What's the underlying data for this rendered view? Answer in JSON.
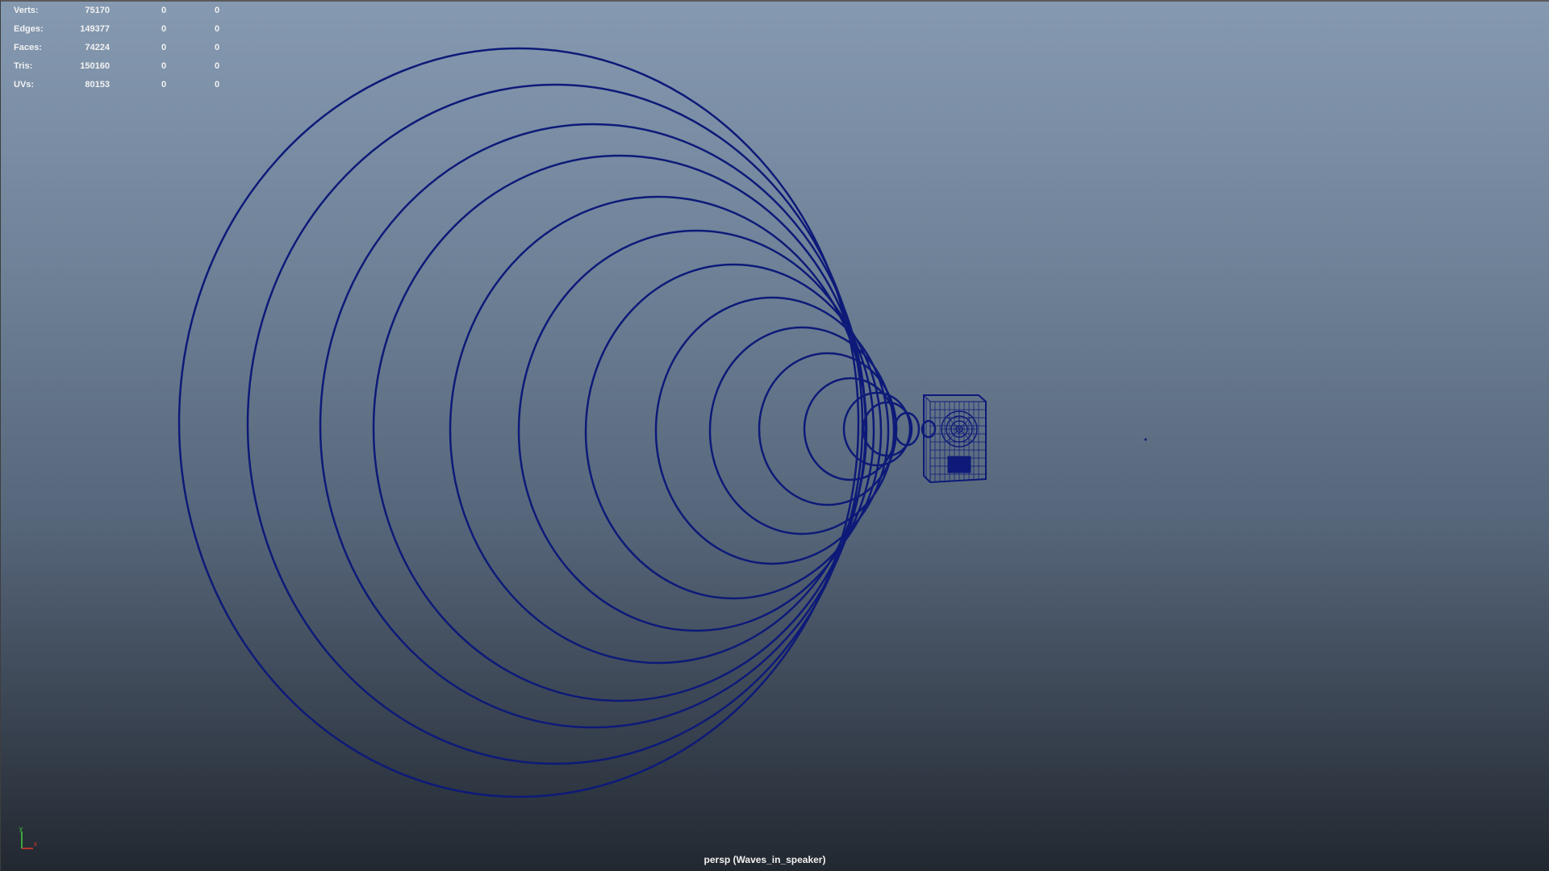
{
  "hud": {
    "rows": [
      {
        "label": "Verts:",
        "value": "75170",
        "selected": "0",
        "component": "0"
      },
      {
        "label": "Edges:",
        "value": "149377",
        "selected": "0",
        "component": "0"
      },
      {
        "label": "Faces:",
        "value": "74224",
        "selected": "0",
        "component": "0"
      },
      {
        "label": "Tris:",
        "value": "150160",
        "selected": "0",
        "component": "0"
      },
      {
        "label": "UVs:",
        "value": "80153",
        "selected": "0",
        "component": "0"
      }
    ]
  },
  "viewport": {
    "camera_label": "persp (Waves_in_speaker)",
    "wireframe_color": "#0d1a78",
    "gradient_top": "#8599b1",
    "gradient_bottom": "#222830"
  },
  "axis_gizmo": {
    "y_label": "y",
    "x_label": "x",
    "y_color": "#3fd13f",
    "x_color": "#e23a2a"
  }
}
